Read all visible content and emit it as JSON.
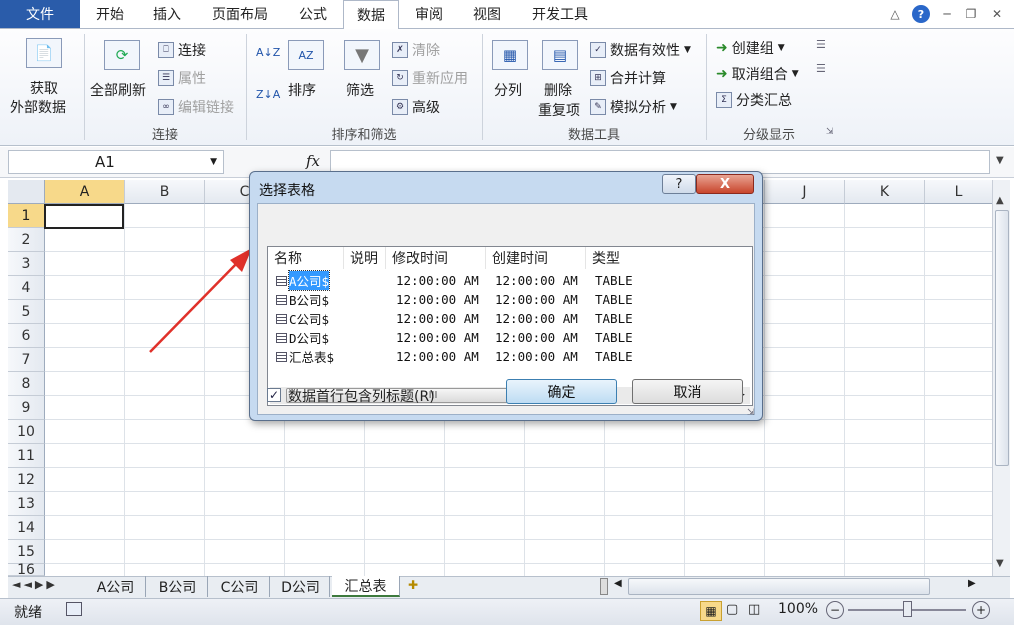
{
  "ribbon_tabs": {
    "file": "文件",
    "items": [
      "开始",
      "插入",
      "页面布局",
      "公式",
      "数据",
      "审阅",
      "视图",
      "开发工具"
    ],
    "active": "数据"
  },
  "ribbon": {
    "get_external": {
      "line1": "获取",
      "line2": "外部数据"
    },
    "refresh_all": "全部刷新",
    "connections": "连接",
    "properties": "属性",
    "edit_links": "编辑链接",
    "group_connections": "连接",
    "sort": "排序",
    "filter": "筛选",
    "clear": "清除",
    "reapply": "重新应用",
    "advanced": "高级",
    "group_sort_filter": "排序和筛选",
    "text_to_columns": "分列",
    "remove_dup": {
      "line1": "删除",
      "line2": "重复项"
    },
    "data_validation": "数据有效性",
    "consolidate": "合并计算",
    "whatif": "模拟分析",
    "group_data_tools": "数据工具",
    "group": "创建组",
    "ungroup": "取消组合",
    "subtotal": "分类汇总",
    "group_outline": "分级显示"
  },
  "formula_bar": {
    "name_box": "A1",
    "fx": "fx"
  },
  "grid": {
    "columns": [
      "A",
      "B",
      "C",
      "D",
      "E",
      "F",
      "G",
      "H",
      "I",
      "J",
      "K",
      "L"
    ],
    "rows": [
      "1",
      "2",
      "3",
      "4",
      "5",
      "6",
      "7",
      "8",
      "9",
      "10",
      "11",
      "12",
      "13",
      "14",
      "15",
      "16"
    ]
  },
  "sheets": {
    "tabs": [
      "A公司",
      "B公司",
      "C公司",
      "D公司",
      "汇总表"
    ],
    "active": "汇总表"
  },
  "status": {
    "ready": "就绪",
    "zoom": "100%"
  },
  "dialog": {
    "title": "选择表格",
    "help": "?",
    "close": "X",
    "headers": [
      "名称",
      "说明",
      "修改时间",
      "创建时间",
      "类型"
    ],
    "rows": [
      {
        "name": "A公司$",
        "desc": "",
        "modified": "12:00:00 AM",
        "created": "12:00:00 AM",
        "type": "TABLE"
      },
      {
        "name": "B公司$",
        "desc": "",
        "modified": "12:00:00 AM",
        "created": "12:00:00 AM",
        "type": "TABLE"
      },
      {
        "name": "C公司$",
        "desc": "",
        "modified": "12:00:00 AM",
        "created": "12:00:00 AM",
        "type": "TABLE"
      },
      {
        "name": "D公司$",
        "desc": "",
        "modified": "12:00:00 AM",
        "created": "12:00:00 AM",
        "type": "TABLE"
      },
      {
        "name": "汇总表$",
        "desc": "",
        "modified": "12:00:00 AM",
        "created": "12:00:00 AM",
        "type": "TABLE"
      }
    ],
    "scroll_thumb": "III",
    "checkbox_label": "数据首行包含列标题(R)",
    "checkbox_checked": true,
    "ok": "确定",
    "cancel": "取消"
  },
  "colors": {
    "accent": "#2a5caa",
    "annotation_arrow": "#e0312a",
    "selection_highlight": "#3399ff"
  }
}
